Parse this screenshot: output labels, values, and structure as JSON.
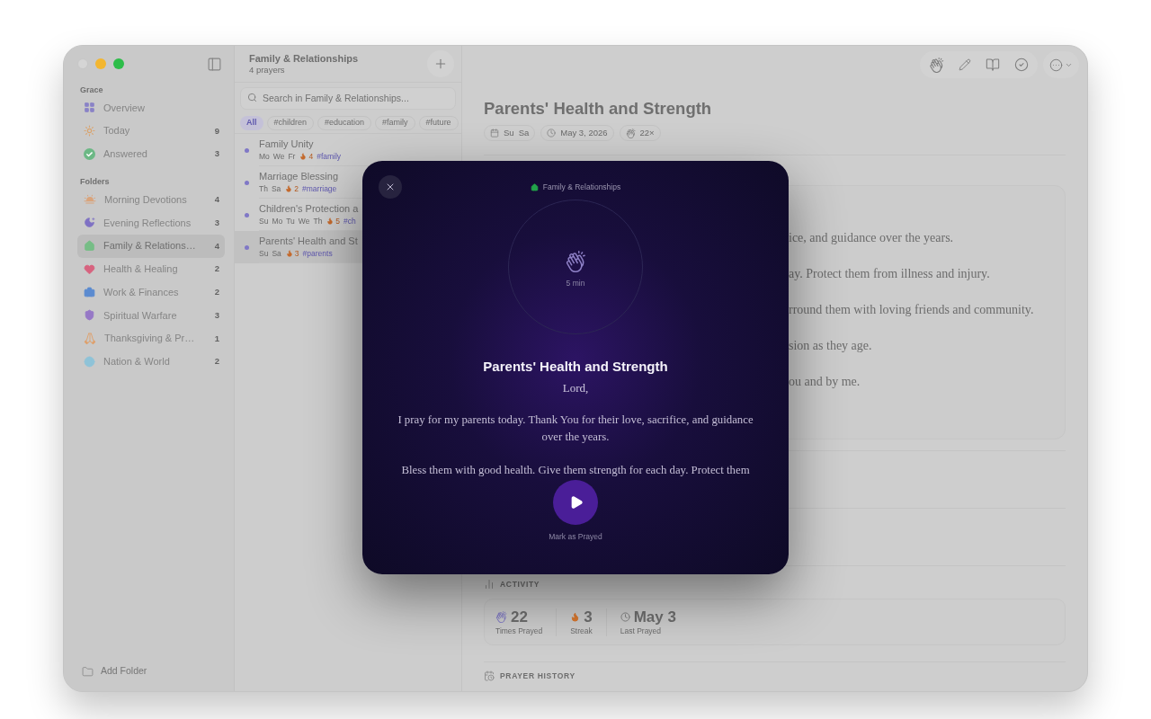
{
  "sidebar": {
    "sections": [
      {
        "title": "Grace",
        "items": [
          {
            "label": "Overview",
            "color": "#8a83c7",
            "selected": false
          },
          {
            "label": "Today",
            "count": "9",
            "color": "#d9a46f",
            "selected": false
          },
          {
            "label": "Answered",
            "count": "3",
            "color": "#6cb885",
            "selected": false
          }
        ]
      },
      {
        "title": "Folders",
        "items": [
          {
            "label": "Morning Devotions",
            "count": "4",
            "color": "#d9a47c",
            "selected": false
          },
          {
            "label": "Evening Reflections",
            "count": "3",
            "color": "#7f71c4",
            "selected": false
          },
          {
            "label": "Family & Relations…",
            "count": "4",
            "color": "#76bd86",
            "selected": true
          },
          {
            "label": "Health & Healing",
            "count": "2",
            "color": "#d7637f",
            "selected": false
          },
          {
            "label": "Work & Finances",
            "count": "2",
            "color": "#5b8bd0",
            "selected": false
          },
          {
            "label": "Spiritual Warfare",
            "count": "3",
            "color": "#9678c6",
            "selected": false
          },
          {
            "label": "Thanksgiving & Pr…",
            "count": "1",
            "color": "#dea06c",
            "selected": false
          },
          {
            "label": "Nation & World",
            "count": "2",
            "color": "#8fc3d8",
            "selected": false
          }
        ]
      }
    ],
    "add_folder": "Add Folder"
  },
  "prayer_list": {
    "title": "Family & Relationships",
    "subtitle": "4 prayers",
    "search": {
      "placeholder": "Search in Family & Relationships..."
    },
    "tags": [
      {
        "label": "All",
        "selected": true
      },
      {
        "label": "#children",
        "selected": false
      },
      {
        "label": "#education",
        "selected": false
      },
      {
        "label": "#family",
        "selected": false
      },
      {
        "label": "#future",
        "selected": false
      }
    ],
    "rows": [
      {
        "title": "Family Unity",
        "days": [
          "Mo",
          "We",
          "Fr"
        ],
        "streak": "4",
        "tag": "#family",
        "selected": false
      },
      {
        "title": "Marriage Blessing",
        "days": [
          "Th",
          "Sa"
        ],
        "streak": "2",
        "tag": "#marriage",
        "selected": false
      },
      {
        "title": "Children's Protection a",
        "days": [
          "Su",
          "Mo",
          "Tu",
          "We",
          "Th"
        ],
        "streak": "5",
        "tag": "#ch",
        "selected": false
      },
      {
        "title": "Parents' Health and St",
        "days": [
          "Su",
          "Sa"
        ],
        "streak": "3",
        "tag": "#parents",
        "selected": true
      }
    ]
  },
  "detail": {
    "title": "Parents' Health and Strength",
    "days": [
      "Su",
      "Sa"
    ],
    "last_prayed": "May 3, 2026",
    "prayed_count": "22×",
    "prayer_text_lines": [
      "ice, and guidance over the years.",
      "ay. Protect them from illness and injury.",
      "rround them with loving friends and community.",
      "sion as they age.",
      "ou and by me."
    ],
    "activity": {
      "heading": "ACTIVITY",
      "stats": [
        {
          "value": "22",
          "label": "Times Prayed"
        },
        {
          "value": "3",
          "label": "Streak"
        },
        {
          "value": "May 3",
          "label": "Last Prayed"
        }
      ]
    },
    "history": {
      "heading": "PRAYER HISTORY"
    }
  },
  "prayer_modal": {
    "folder": "Family & Relationships",
    "duration": "5 min",
    "title": "Parents' Health and Strength",
    "greeting": "Lord,",
    "paragraphs": [
      "I pray for my parents today. Thank You for their love, sacrifice, and guidance over the years.",
      "Bless them with good health. Give them strength for each day. Protect them"
    ],
    "action_label": "Mark as Prayed"
  }
}
